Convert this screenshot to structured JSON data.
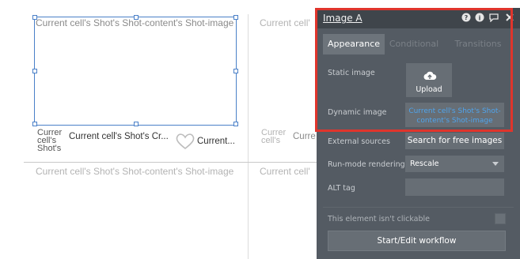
{
  "canvas": {
    "ghost_top_left": "Current cell's Shot's Shot-content's Shot-image",
    "ghost_top_right": "Current cell'",
    "stack_text": "Currer cell's Shot's",
    "caption_text": "Current cell's Shot's Cr...",
    "heart_caption": "Current...",
    "ghost_row2_stack": "Currer cell's",
    "ghost_row2_right": "Curre",
    "ghost_bottom_left": "Current cell's Shot's Shot-content's Shot-image",
    "ghost_bottom_right": "Current cell'"
  },
  "panel": {
    "title": "Image A",
    "tabs": [
      {
        "label": "Appearance",
        "active": true
      },
      {
        "label": "Conditional",
        "active": false
      },
      {
        "label": "Transitions",
        "active": false
      }
    ],
    "static_image_label": "Static image",
    "upload_label": "Upload",
    "dynamic_image_label": "Dynamic image",
    "dynamic_image_value": "Current cell's Shot's Shot-content's Shot-image",
    "external_sources_label": "External sources",
    "search_free_images_label": "Search for free images",
    "run_mode_label": "Run-mode rendering",
    "run_mode_value": "Rescale",
    "alt_tag_label": "ALT tag",
    "alt_tag_value": "",
    "not_clickable_label": "This element isn't clickable",
    "workflow_button_label": "Start/Edit workflow"
  },
  "colors": {
    "panel_bg": "#545b63",
    "panel_header": "#3f454b",
    "highlight_border": "#e0352c",
    "selection_blue": "#4a80c8",
    "dynamic_text": "#4fa4ec"
  },
  "icons": [
    "help-icon",
    "info-icon",
    "comment-icon",
    "close-icon",
    "cloud-upload-icon",
    "heart-icon",
    "dropdown-caret-icon"
  ]
}
